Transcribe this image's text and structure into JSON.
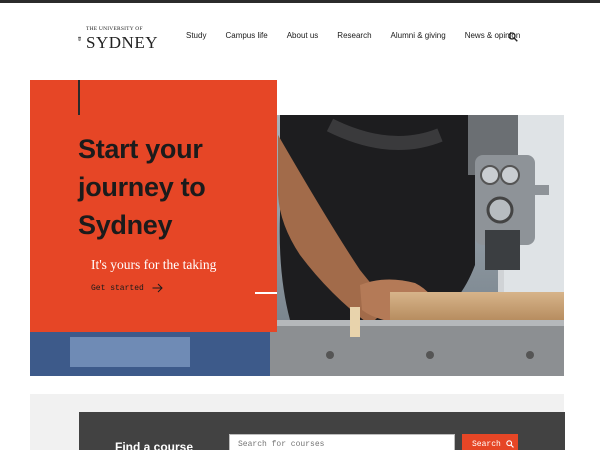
{
  "brand": {
    "small_text": "THE UNIVERSITY OF",
    "big_text": "SYDNEY"
  },
  "nav": {
    "items": [
      {
        "label": "Study"
      },
      {
        "label": "Campus life"
      },
      {
        "label": "About us"
      },
      {
        "label": "Research"
      },
      {
        "label": "Alumni & giving"
      },
      {
        "label": "News & opinion"
      }
    ],
    "search_icon": "search-icon"
  },
  "hero": {
    "title": "Start your journey to Sydney",
    "subtitle": "It's yours for the taking",
    "cta_label": "Get started",
    "cta_icon": "arrow-right-icon",
    "accent_color": "#e64626"
  },
  "finder": {
    "title": "Find a course",
    "input_placeholder": "Search for courses",
    "button_label": "Search",
    "button_icon": "search-icon"
  }
}
